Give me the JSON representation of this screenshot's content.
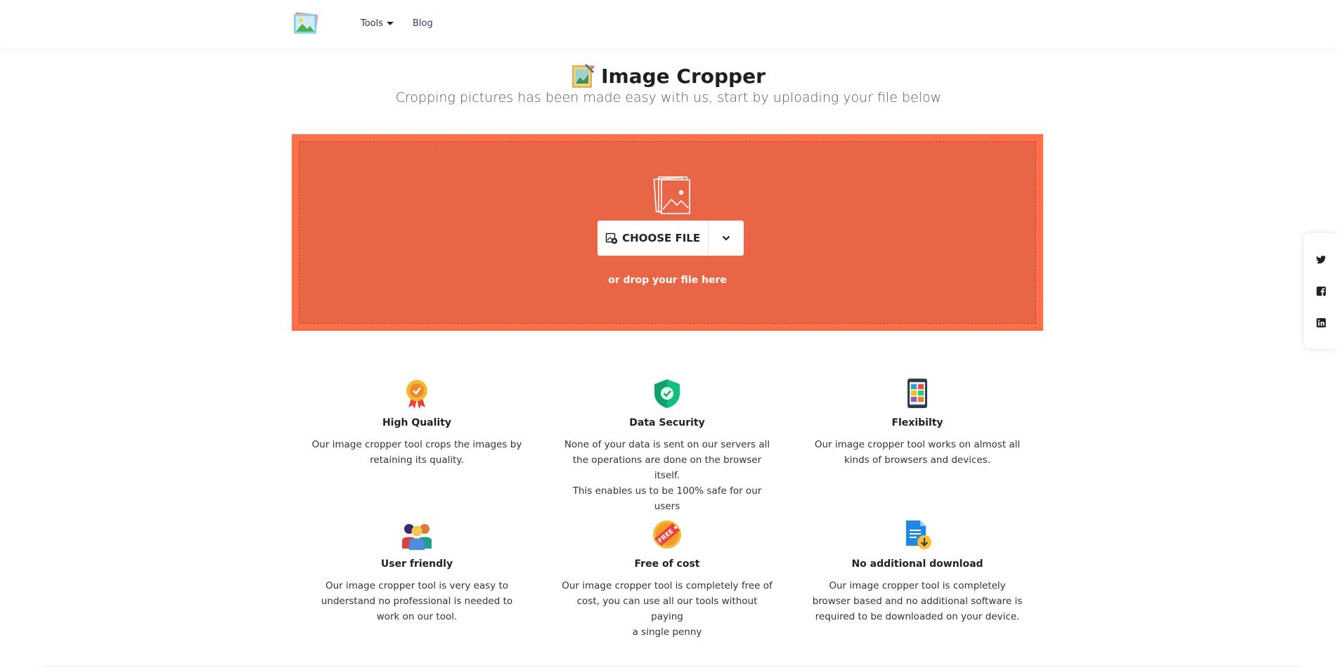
{
  "header": {
    "logo_icon": "gallery-logo-icon",
    "nav": [
      {
        "label": "Tools",
        "has_dropdown": true
      },
      {
        "label": "Blog"
      }
    ]
  },
  "hero": {
    "title": "Image Cropper",
    "title_icon": "crop-picture-icon",
    "subtitle": "Cropping pictures has been made easy with us, start by uploading your file below"
  },
  "dropzone": {
    "background_color": "#ff6f4a",
    "inner_color": "#e86545",
    "choose_file_label": "CHOOSE FILE",
    "choose_file_icon": "file-add-icon",
    "dropdown_icon": "chevron-down-icon",
    "drop_text": "or drop your file here",
    "upload_icon": "images-stack-icon"
  },
  "features": [
    {
      "icon": "award-ribbon-icon",
      "title": "High Quality",
      "desc_lines": [
        "Our image cropper tool crops the images by",
        "retaining its quality."
      ]
    },
    {
      "icon": "shield-check-icon",
      "title": "Data Security",
      "desc_lines": [
        "None of your data is sent on our servers all",
        "the operations are done on the browser itself.",
        "This enables us to be 100% safe for our users"
      ]
    },
    {
      "icon": "mobile-apps-icon",
      "title": "Flexibilty",
      "desc_lines": [
        "Our image cropper tool works on almost all",
        "kinds of browsers and devices."
      ]
    },
    {
      "icon": "users-group-icon",
      "title": "User friendly",
      "desc_lines": [
        "Our image cropper tool is very easy to",
        "understand no professional is needed to",
        "work on our tool."
      ]
    },
    {
      "icon": "free-tag-icon",
      "title": "Free of cost",
      "desc_lines": [
        "Our image cropper tool is completely free of",
        "cost, you can use all our tools without paying",
        "a single penny"
      ]
    },
    {
      "icon": "file-download-icon",
      "title": "No additional download",
      "desc_lines": [
        "Our image cropper tool is completely",
        "browser based and no additional software is",
        "required to be downloaded on your device."
      ]
    }
  ],
  "share": [
    {
      "icon": "twitter-icon"
    },
    {
      "icon": "facebook-icon"
    },
    {
      "icon": "linkedin-icon"
    }
  ]
}
